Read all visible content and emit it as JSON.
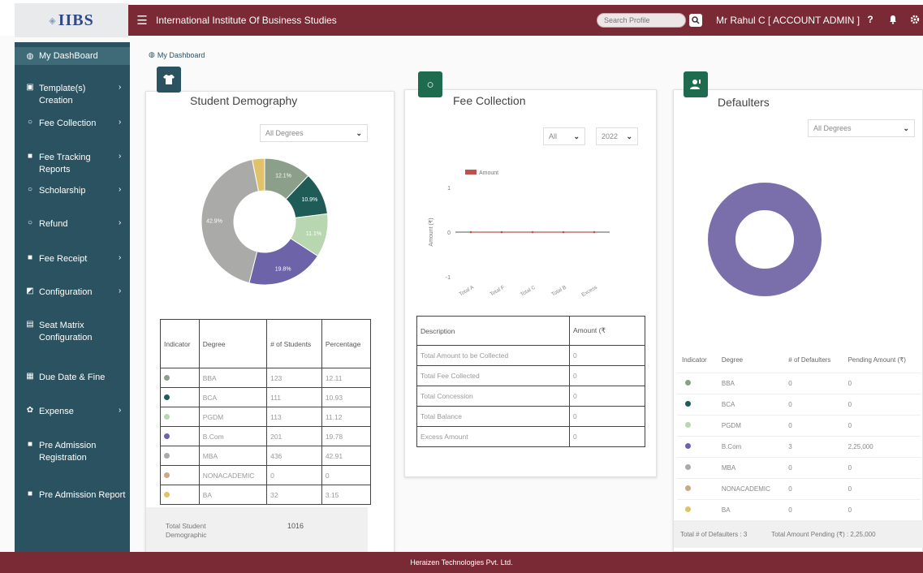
{
  "header": {
    "logo_text": "IIBS",
    "title": "International Institute Of Business Studies",
    "search_placeholder": "Search Profile",
    "user": "Mr Rahul C [ ACCOUNT ADMIN ]",
    "colors": {
      "maroon": "#7a2a35",
      "sidebar": "#2b5260"
    }
  },
  "sidebar": {
    "items": [
      {
        "label": "My DashBoard",
        "icon": "dashboard-icon"
      },
      {
        "label": "Template(s) Creation",
        "icon": "template-icon"
      },
      {
        "label": "Fee Collection",
        "icon": "circle-icon"
      },
      {
        "label": "Fee Tracking Reports",
        "icon": "report-icon"
      },
      {
        "label": "Scholarship",
        "icon": "circle-icon"
      },
      {
        "label": "Refund",
        "icon": "circle-icon"
      },
      {
        "label": "Fee Receipt",
        "icon": "receipt-icon"
      },
      {
        "label": "Configuration",
        "icon": "config-icon"
      },
      {
        "label": "Seat Matrix Configuration",
        "icon": "seat-icon"
      },
      {
        "label": "Due Date & Fine",
        "icon": "calendar-icon"
      },
      {
        "label": "Expense",
        "icon": "gear-icon"
      },
      {
        "label": "Pre Admission Registration",
        "icon": "document-icon"
      },
      {
        "label": "Pre Admission Report",
        "icon": "document-icon"
      }
    ]
  },
  "breadcrumb": {
    "label": "My Dashboard"
  },
  "demography": {
    "title": "Student Demography",
    "filter": "All Degrees",
    "headers": [
      "Indicator",
      "Degree",
      "# of Students",
      "Percentage"
    ],
    "rows": [
      {
        "degree": "BBA",
        "students": "123",
        "pct": "12.11",
        "color": "#8c9f8a"
      },
      {
        "degree": "BCA",
        "students": "111",
        "pct": "10.93",
        "color": "#1f5c57"
      },
      {
        "degree": "PGDM",
        "students": "113",
        "pct": "11.12",
        "color": "#b8d6b0"
      },
      {
        "degree": "B.Com",
        "students": "201",
        "pct": "19.78",
        "color": "#6d63a8"
      },
      {
        "degree": "MBA",
        "students": "436",
        "pct": "42.91",
        "color": "#aaaaa8"
      },
      {
        "degree": "NONACADEMIC",
        "students": "0",
        "pct": "0",
        "color": "#c8a98a"
      },
      {
        "degree": "BA",
        "students": "32",
        "pct": "3.15",
        "color": "#e0c26a"
      }
    ],
    "total_label": "Total Student Demographic",
    "total_value": "1016"
  },
  "fee": {
    "title": "Fee Collection",
    "filter_a": "All",
    "filter_b": "2022",
    "headers": [
      "Description",
      "Amount (₹"
    ],
    "rows": [
      {
        "desc": "Total Amount to be Collected",
        "amount": "0"
      },
      {
        "desc": "Total Fee Collected",
        "amount": "0"
      },
      {
        "desc": "Total Concession",
        "amount": "0"
      },
      {
        "desc": "Total Balance",
        "amount": "0"
      },
      {
        "desc": "Excess Amount",
        "amount": "0"
      }
    ]
  },
  "chart_data": [
    {
      "type": "pie",
      "title": "Student Demography",
      "categories": [
        "BBA",
        "BCA",
        "PGDM",
        "B.Com",
        "MBA",
        "NONACADEMIC",
        "BA"
      ],
      "values": [
        12.11,
        10.93,
        11.12,
        19.78,
        42.91,
        0,
        3.15
      ],
      "labels": [
        "12.1%",
        "10.9%",
        "11.1%",
        "19.8%",
        "42.9%",
        "",
        ""
      ],
      "colors": [
        "#8c9f8a",
        "#1f5c57",
        "#b8d6b0",
        "#6d63a8",
        "#aaaaa8",
        "#c8a98a",
        "#e0c26a"
      ],
      "donut": true
    },
    {
      "type": "line",
      "title": "",
      "ylabel": "Amount (₹)",
      "categories": [
        "Total A",
        "Total F",
        "Total C",
        "Total B",
        "Excess"
      ],
      "series": [
        {
          "name": "Amount",
          "values": [
            0,
            0,
            0,
            0,
            0
          ],
          "color": "#c0504d"
        }
      ],
      "ylim": [
        -1,
        1
      ],
      "yticks": [
        "1",
        "0",
        "-1"
      ]
    },
    {
      "type": "pie",
      "title": "Defaulters",
      "categories": [
        "B.Com"
      ],
      "values": [
        100
      ],
      "colors": [
        "#7a6fab"
      ],
      "donut": true
    }
  ],
  "defaulters": {
    "title": "Defaulters",
    "filter": "All Degrees",
    "headers": [
      "Indicator",
      "Degree",
      "# of Defaulters",
      "Pending Amount (₹)"
    ],
    "rows": [
      {
        "degree": "BBA",
        "count": "0",
        "amount": "0",
        "color": "#8c9f8a"
      },
      {
        "degree": "BCA",
        "count": "0",
        "amount": "0",
        "color": "#1f5c57"
      },
      {
        "degree": "PGDM",
        "count": "0",
        "amount": "0",
        "color": "#b8d6b0"
      },
      {
        "degree": "B.Com",
        "count": "3",
        "amount": "2,25,000",
        "color": "#6d63a8"
      },
      {
        "degree": "MBA",
        "count": "0",
        "amount": "0",
        "color": "#aaaaa8"
      },
      {
        "degree": "NONACADEMIC",
        "count": "0",
        "amount": "0",
        "color": "#c8a98a"
      },
      {
        "degree": "BA",
        "count": "0",
        "amount": "0",
        "color": "#e0c26a"
      }
    ],
    "total_count_label": "Total # of Defaulters : 3",
    "total_amount_label": "Total Amount Pending (₹) : 2,25,000"
  },
  "footer": {
    "text": "Heraizen Technologies Pvt. Ltd."
  }
}
